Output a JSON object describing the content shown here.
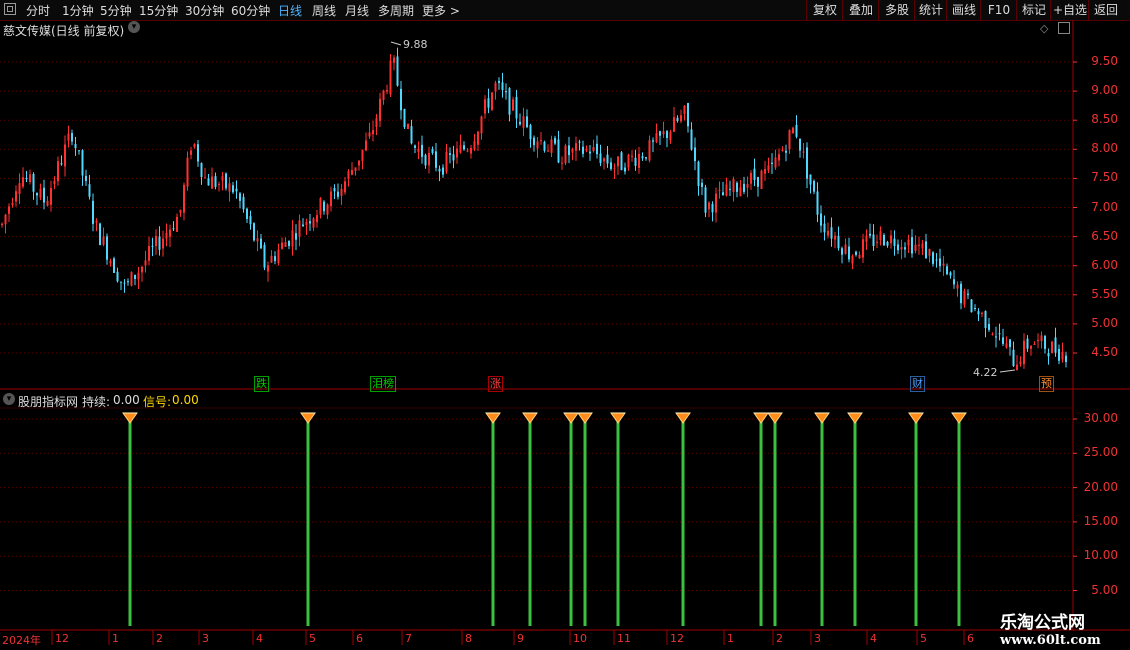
{
  "toolbar": {
    "periods": [
      "分时",
      "1分钟",
      "5分钟",
      "15分钟",
      "30分钟",
      "60分钟",
      "日线",
      "周线",
      "月线",
      "多周期",
      "更多 >"
    ],
    "active_period": "日线",
    "right_buttons": [
      "复权",
      "叠加",
      "多股",
      "统计",
      "画线",
      "F10",
      "标记",
      "+自选",
      "返回"
    ]
  },
  "main_chart": {
    "title": "慈文传媒(日线 前复权)",
    "high_label": "9.88",
    "low_label": "4.22",
    "yaxis": [
      "9.50",
      "9.00",
      "8.50",
      "8.00",
      "7.50",
      "7.00",
      "6.50",
      "6.00",
      "5.50",
      "5.00",
      "4.50"
    ],
    "signals": [
      {
        "text": "跌",
        "color": "#00c000"
      },
      {
        "text": "泪榜",
        "color": "#00c000"
      },
      {
        "text": "涨",
        "color": "#e02020"
      },
      {
        "text": "财",
        "color": "#3a7fd0"
      },
      {
        "text": "预",
        "color": "#e07020"
      }
    ]
  },
  "indicator": {
    "title": "股朋指标网",
    "label1": "持续:",
    "val1": "0.00",
    "label2": "信号:",
    "val2": "0.00",
    "yaxis": [
      "30.00",
      "25.00",
      "20.00",
      "15.00",
      "10.00",
      "5.00"
    ]
  },
  "chart_data": {
    "type": "bar",
    "series_candles": "candlestick price data (approx.)",
    "ylim_price": [
      4.2,
      9.9
    ],
    "ylim_indicator": [
      0,
      32
    ],
    "signal_bars": [
      130,
      308,
      493,
      530,
      571,
      585,
      618,
      683,
      761,
      775,
      822,
      855,
      916,
      959
    ],
    "signal_value": 30
  },
  "dates": [
    "2024年",
    "12",
    "1",
    "2",
    "3",
    "4",
    "5",
    "6",
    "7",
    "8",
    "9",
    "10",
    "11",
    "12",
    "1",
    "2",
    "3",
    "4",
    "5",
    "6"
  ],
  "watermark": {
    "line1": "乐淘公式网",
    "line2": "www.60lt.com"
  }
}
